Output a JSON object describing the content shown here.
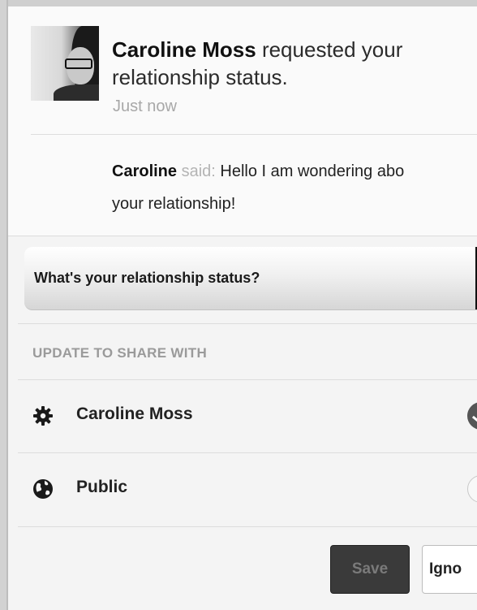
{
  "request": {
    "requester_name": "Caroline Moss",
    "action_text": " requested your relationship status.",
    "timestamp": "Just now",
    "message_sender": "Caroline",
    "message_verb": " said: ",
    "message_line1": "Hello I am wondering abo",
    "message_line2": "your relationship!"
  },
  "question": {
    "label": "What's your relationship status?"
  },
  "share": {
    "section_label": "UPDATE TO SHARE WITH",
    "options": [
      {
        "label": "Caroline Moss",
        "icon": "gear-icon",
        "selected": true
      },
      {
        "label": "Public",
        "icon": "globe-icon",
        "selected": false
      }
    ]
  },
  "actions": {
    "save_label": "Save",
    "ignore_label": "Igno"
  },
  "colors": {
    "save_bg": "#3a3a3a",
    "muted_text": "#a8a8a8",
    "selected_radio": "#555555"
  }
}
